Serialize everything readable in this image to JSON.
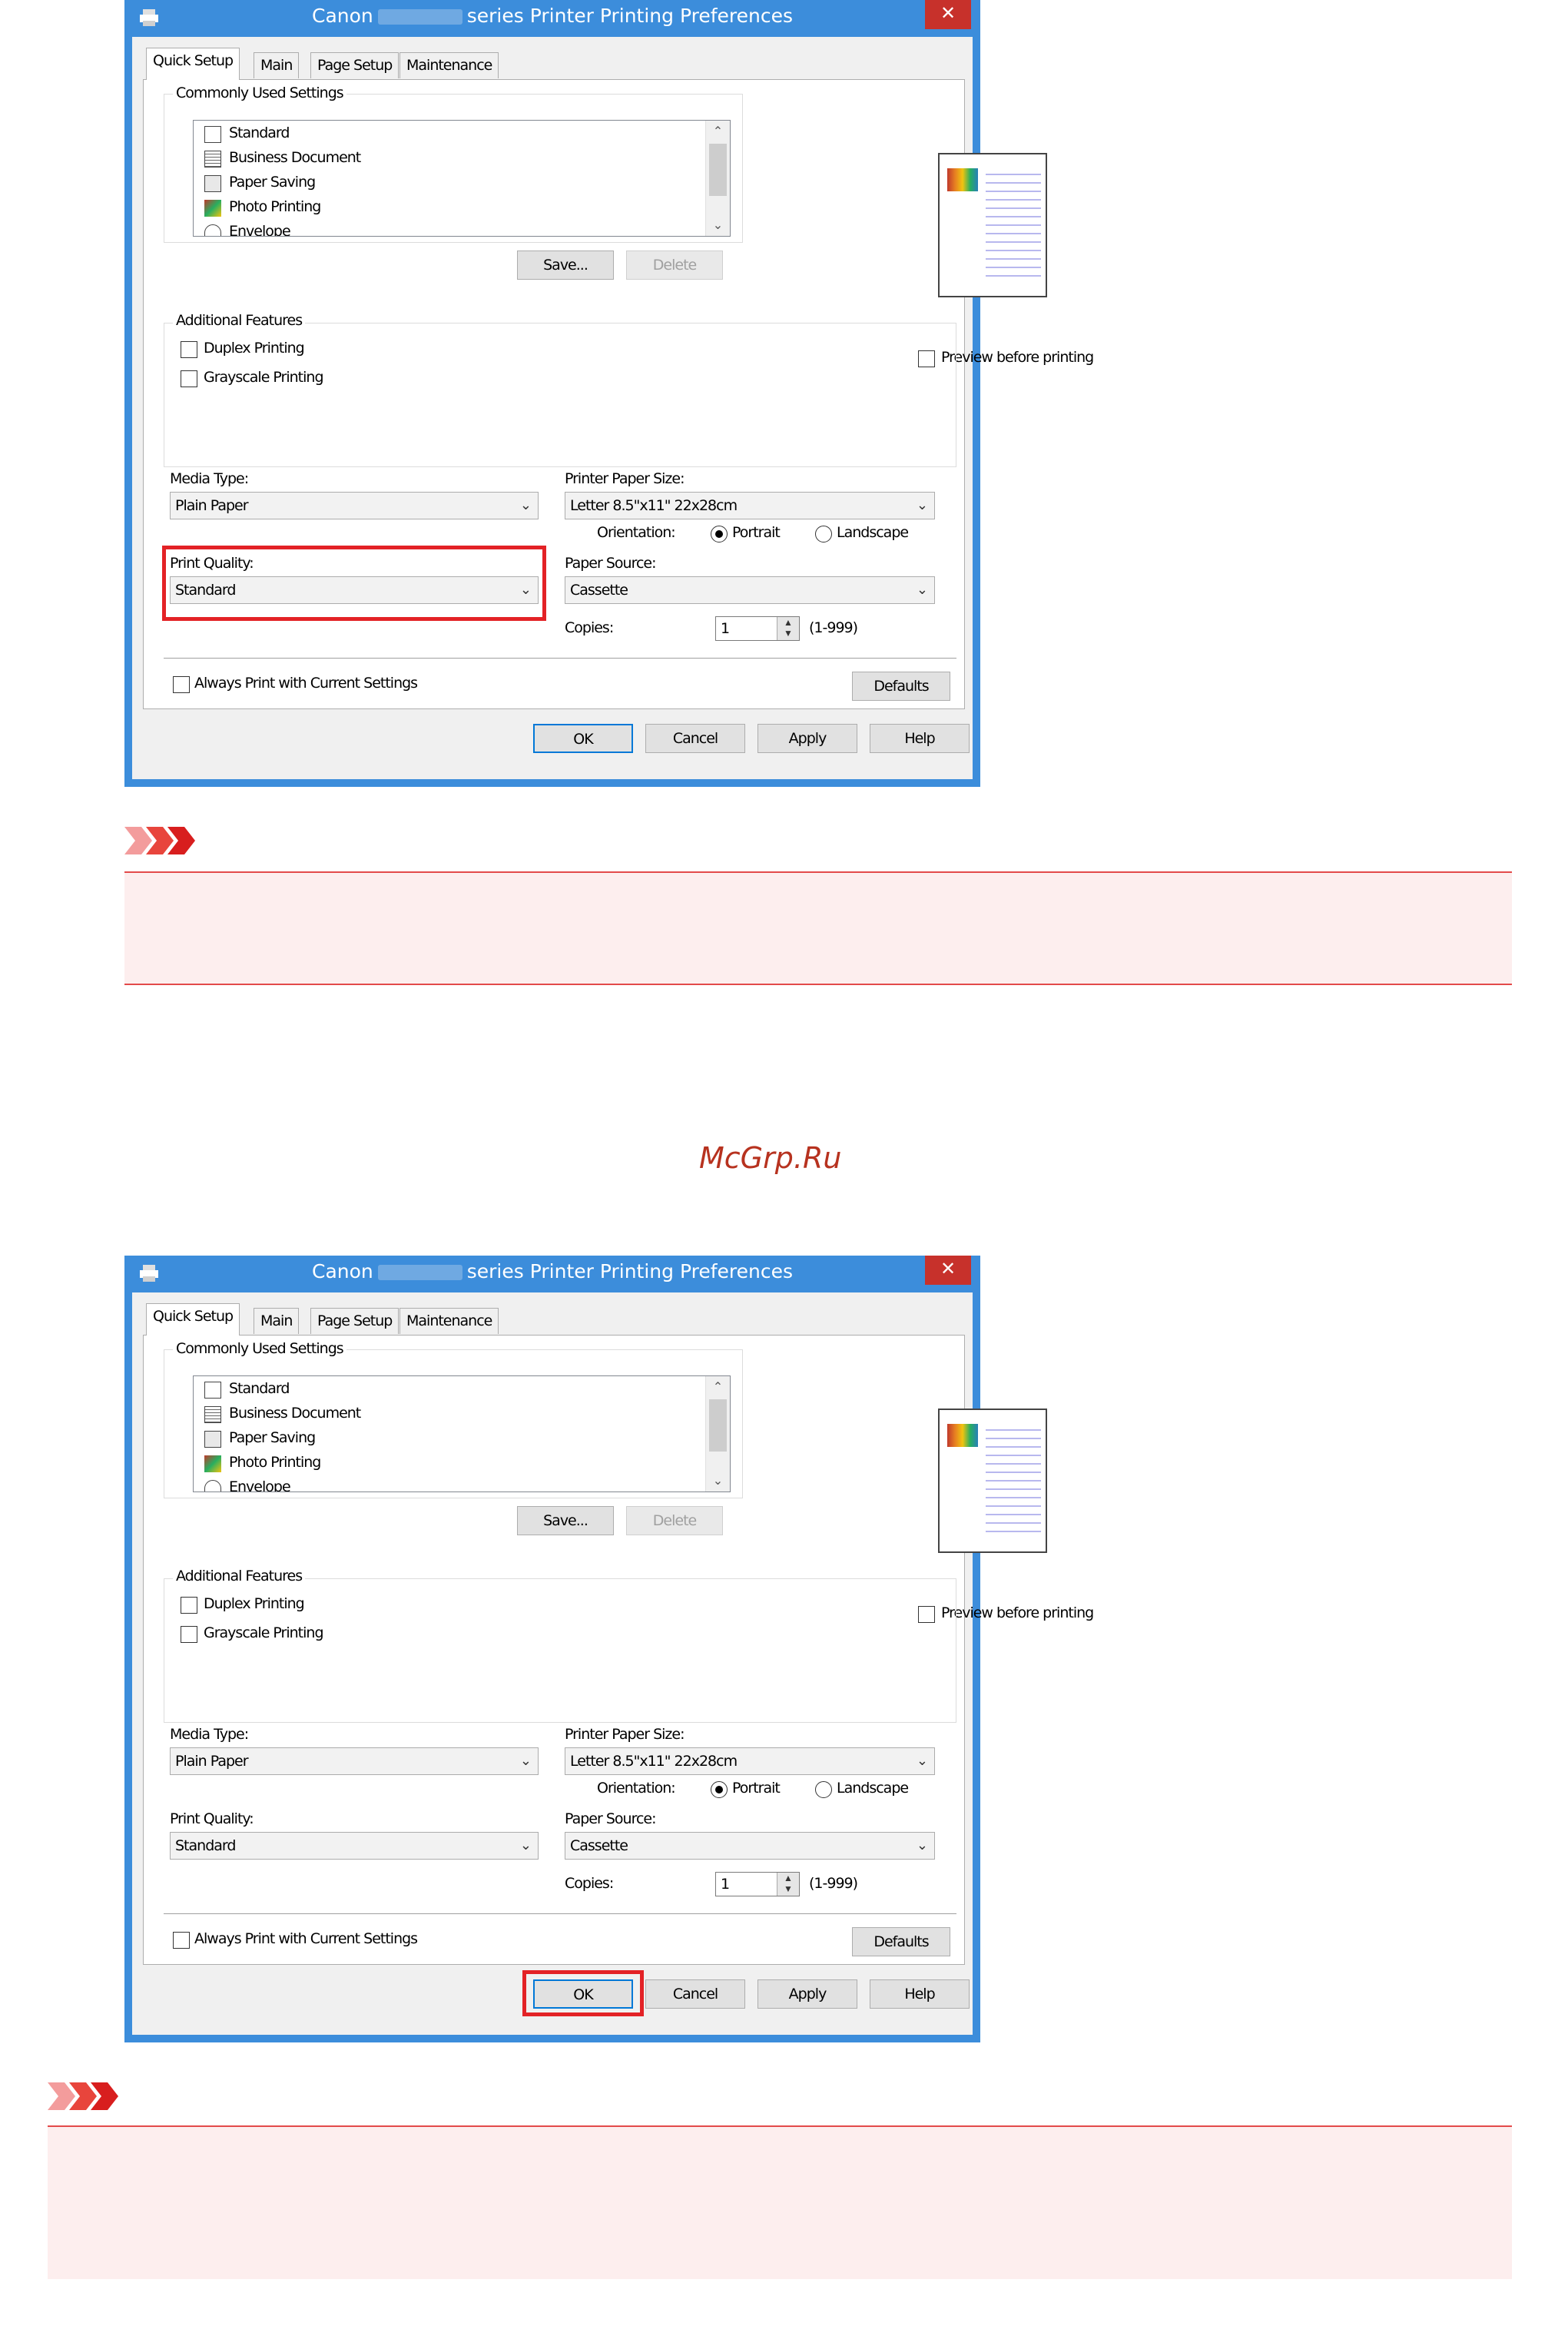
{
  "dialog": {
    "title_left": "Canon",
    "title_right": "series Printer Printing Preferences",
    "close_glyph": "✕",
    "tabs": [
      {
        "label": "Quick Setup"
      },
      {
        "label": "Main"
      },
      {
        "label": "Page Setup"
      },
      {
        "label": "Maintenance"
      }
    ],
    "commonly_used_label": "Commonly Used Settings",
    "commonly_used_items": [
      {
        "label": "Standard",
        "icon": "standard-icon"
      },
      {
        "label": "Business Document",
        "icon": "document-icon"
      },
      {
        "label": "Paper Saving",
        "icon": "paper-saving-icon"
      },
      {
        "label": "Photo Printing",
        "icon": "photo-icon"
      },
      {
        "label": "Envelope",
        "icon": "envelope-icon"
      }
    ],
    "save_label": "Save...",
    "delete_label": "Delete",
    "preview_label": "Preview before printing",
    "additional_features_label": "Additional Features",
    "duplex_label": "Duplex Printing",
    "grayscale_label": "Grayscale Printing",
    "media_type_label": "Media Type:",
    "media_type_value": "Plain Paper",
    "printer_paper_size_label": "Printer Paper Size:",
    "printer_paper_size_value": "Letter 8.5\"x11\" 22x28cm",
    "orientation_label": "Orientation:",
    "portrait_label": "Portrait",
    "landscape_label": "Landscape",
    "print_quality_label": "Print Quality:",
    "print_quality_value": "Standard",
    "paper_source_label": "Paper Source:",
    "paper_source_value": "Cassette",
    "copies_label": "Copies:",
    "copies_value": "1",
    "copies_range": "(1-999)",
    "always_print_label": "Always Print with Current Settings",
    "defaults_label": "Defaults",
    "ok_label": "OK",
    "cancel_label": "Cancel",
    "apply_label": "Apply",
    "help_label": "Help"
  },
  "watermark": "McGrp.Ru",
  "colors": {
    "titlebar": "#3c8ddb",
    "highlight": "#e32226",
    "caution_bg": "#fdeeee",
    "caution_line": "#e34a4a"
  }
}
